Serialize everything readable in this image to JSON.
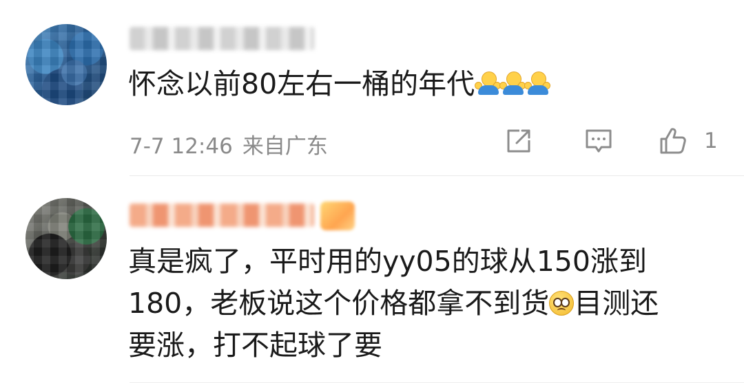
{
  "comments": [
    {
      "text": "怀念以前80左右一桶的年代",
      "emojis": [
        "shrug-emoji",
        "shrug-emoji",
        "shrug-emoji"
      ],
      "date": "7-7 12:46",
      "location": "来自广东",
      "like_count": "1",
      "icons": [
        "repost-icon",
        "comment-icon",
        "like-icon"
      ]
    },
    {
      "line1": "真是疯了，平时用的yy05的球从150涨到",
      "line2_before": "180，老板说这个价格都拿不到货",
      "line2_emoji": "pleading-face-emoji",
      "line2_after": "目测还",
      "line3": "要涨，打不起球了要"
    }
  ],
  "colors": {
    "text": "#1a1a1a",
    "meta": "#8a8a8a",
    "divider": "#e9e9e9",
    "icon_stroke": "#8c8c8c"
  }
}
